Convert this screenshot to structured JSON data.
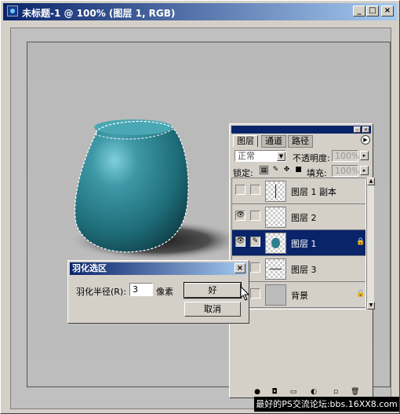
{
  "window": {
    "title": "未标题-1 @ 100% (图层 1, RGB)",
    "buttons": {
      "minimize": "_",
      "maximize": "□",
      "close": "×"
    }
  },
  "layers_panel": {
    "tabs": [
      {
        "label": "图层",
        "active": true
      },
      {
        "label": "通道",
        "active": false
      },
      {
        "label": "路径",
        "active": false
      }
    ],
    "blend_mode": "正常",
    "opacity_label": "不透明度:",
    "opacity_value": "100%",
    "lock_label": "锁定:",
    "fill_label": "填充:",
    "fill_value": "100%",
    "layers": [
      {
        "name": "图层 1 副本",
        "visible": false,
        "selected": false,
        "thumb": "checker-vertical-line",
        "locked": false
      },
      {
        "name": "图层 2",
        "visible": true,
        "selected": false,
        "thumb": "checker",
        "locked": false
      },
      {
        "name": "图层 1",
        "visible": true,
        "selected": true,
        "thumb": "teal-shape",
        "locked": true
      },
      {
        "name": "图层 3",
        "visible": false,
        "selected": false,
        "thumb": "checker-horizontal-line",
        "locked": false
      },
      {
        "name": "背景",
        "visible": false,
        "selected": false,
        "thumb": "gray",
        "locked": true
      }
    ],
    "icons": [
      "eye-icon",
      "brush-icon",
      "lock-icon",
      "move-icon",
      "checker-lock-icon"
    ]
  },
  "feather_dialog": {
    "title": "羽化选区",
    "radius_label": "羽化半径(R):",
    "radius_value": "3",
    "unit_label": "像素",
    "ok_label": "好",
    "cancel_label": "取消",
    "close_glyph": "×"
  },
  "watermark": "最好的PS交流论坛:bbs.16XX8.com",
  "colors": {
    "titlebar": "#0a246a",
    "panel_bg": "#d4d0c8",
    "selection": "#0a246a",
    "vase": "#2c7f8c",
    "artboard": "#bcbcbc"
  }
}
